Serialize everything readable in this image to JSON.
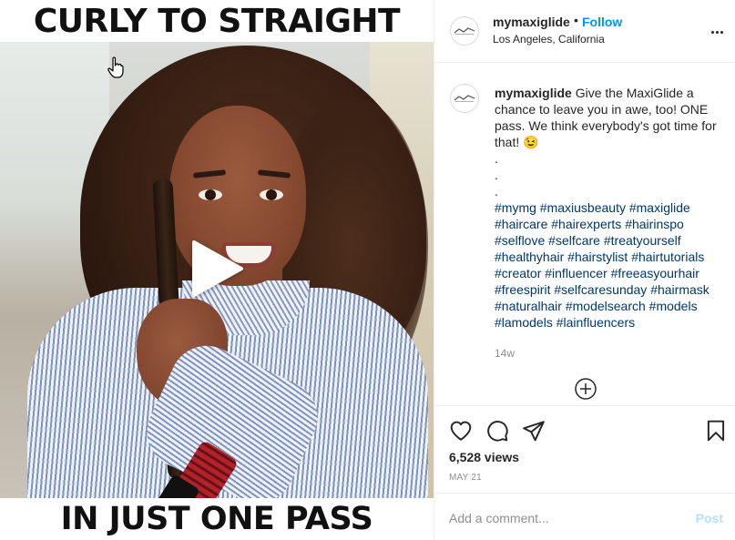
{
  "media": {
    "top_text": "CURLY TO STRAIGHT",
    "bottom_text": "IN JUST ONE PASS"
  },
  "header": {
    "username": "mymaxiglide",
    "separator": "•",
    "follow_label": "Follow",
    "location": "Los Angeles, California"
  },
  "caption": {
    "username": "mymaxiglide",
    "text": "Give the MaxiGlide a chance to leave you in awe, too! ONE pass. We think everybody's got time for that! 😉",
    "dots": [
      ".",
      ".",
      "."
    ],
    "hashtags": [
      "#mymg",
      "#maxiusbeauty",
      "#maxiglide",
      "#haircare",
      "#hairexperts",
      "#hairinspo",
      "#selflove",
      "#selfcare",
      "#treatyourself",
      "#healthyhair",
      "#hairstylist",
      "#hairtutorials",
      "#creator",
      "#influencer",
      "#freeasyourhair",
      "#freespirit",
      "#selfcaresunday",
      "#hairmask",
      "#naturalhair",
      "#modelsearch",
      "#models",
      "#lamodels",
      "#lainfluencers"
    ],
    "time_ago": "14w"
  },
  "stats": {
    "views": "6,528 views",
    "date": "MAY 21"
  },
  "comment_box": {
    "placeholder": "Add a comment...",
    "post_label": "Post"
  },
  "colors": {
    "link_blue": "#0095f6",
    "hashtag": "#00376b",
    "muted": "#8e8e8e",
    "post_disabled": "#b2dffc"
  }
}
